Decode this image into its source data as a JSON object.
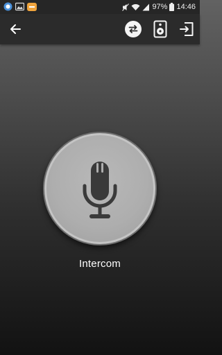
{
  "status_bar": {
    "battery_percent": "97%",
    "time": "14:46",
    "notification_icons": [
      "sync-notification-icon",
      "gallery-notification-icon",
      "app-notification-icon"
    ],
    "system_icons": [
      "mute-icon",
      "wifi-icon",
      "signal-icon",
      "battery-icon"
    ]
  },
  "toolbar": {
    "icons": [
      "back-arrow-icon",
      "swap-icon",
      "speaker-icon",
      "exit-icon"
    ]
  },
  "main": {
    "mic_label": "Intercom",
    "mic_icon": "microphone-icon"
  },
  "colors": {
    "toolbar_bg": "#2b2b2b",
    "status_bar_bg": "#262626",
    "mic_button_fill": "#aeaeae",
    "mic_glyph": "#3a3a3a",
    "text": "#ffffff"
  }
}
